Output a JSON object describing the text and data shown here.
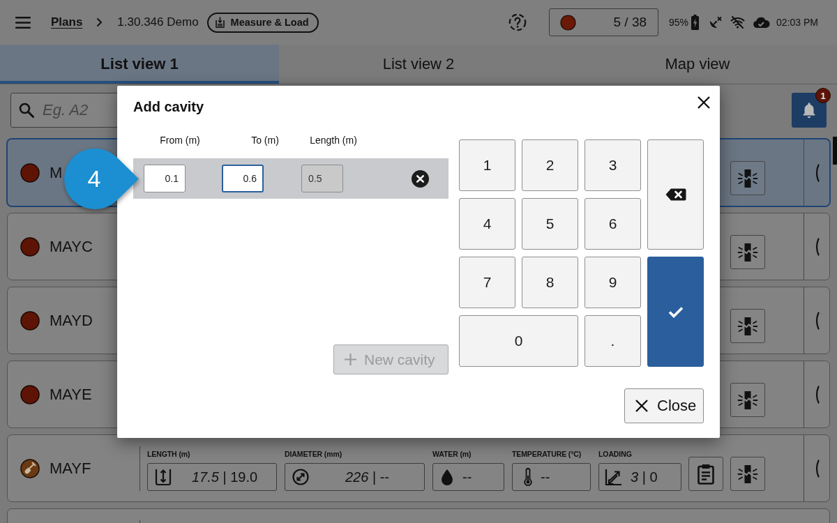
{
  "top_bar": {
    "breadcrumb_link": "Plans",
    "project": "1.30.346 Demo",
    "mode_chip": "Measure & Load",
    "counter": "5 / 38",
    "battery": "95%",
    "time": "02:03 PM"
  },
  "tabs": [
    {
      "label": "List view 1",
      "selected": true
    },
    {
      "label": "List view 2",
      "selected": false
    },
    {
      "label": "Map view",
      "selected": false
    }
  ],
  "search": {
    "placeholder": "Eg. A2"
  },
  "notifications": {
    "badge": "1"
  },
  "rows": [
    {
      "name": "M",
      "selected": true,
      "marker": {
        "kind": "dot",
        "color": "#5e1405"
      },
      "actions": [
        {
          "kind": "breakage"
        }
      ]
    },
    {
      "name": "MAYC",
      "selected": false,
      "marker": {
        "kind": "dot",
        "color": "#5e1405"
      },
      "actions": [
        {
          "kind": "breakage"
        }
      ]
    },
    {
      "name": "MAYD",
      "selected": false,
      "marker": {
        "kind": "dot",
        "color": "#5e1405"
      },
      "actions": [
        {
          "kind": "breakage"
        }
      ]
    },
    {
      "name": "MAYE",
      "selected": false,
      "marker": {
        "kind": "dot",
        "color": "#5e1405"
      },
      "actions": [
        {
          "kind": "breakage"
        }
      ]
    },
    {
      "name": "MAYF",
      "selected": false,
      "marker": {
        "kind": "shovel",
        "color": "#6b3a12"
      },
      "fields": [
        {
          "kind": "length",
          "label": "LENGTH (m)",
          "value": "*17.5* | 19.0"
        },
        {
          "kind": "diameter",
          "label": "DIAMETER (mm)",
          "value": "*226* | --"
        },
        {
          "kind": "water",
          "label": "WATER (m)",
          "value": "--"
        },
        {
          "kind": "temperature",
          "label": "TEMPERATURE (°C)",
          "value": "--"
        },
        {
          "kind": "loading",
          "label": "LOADING",
          "value": "*3* | 0"
        }
      ],
      "actions": [
        {
          "kind": "clipboard"
        },
        {
          "kind": "breakage"
        }
      ]
    }
  ],
  "dialog": {
    "title": "Add cavity",
    "columns": [
      "From (m)",
      "To (m)",
      "Length (m)"
    ],
    "cavities": [
      {
        "inputs": [
          {
            "value": "0.1",
            "focused": false,
            "disabled": false
          },
          {
            "value": "0.6",
            "focused": true,
            "disabled": false
          },
          {
            "value": "0.5",
            "focused": false,
            "disabled": true
          }
        ]
      }
    ],
    "new_cavity": {
      "label": "New cavity",
      "disabled": true
    },
    "keypad": [
      {
        "kind": "key",
        "label": "1"
      },
      {
        "kind": "key",
        "label": "2"
      },
      {
        "kind": "key",
        "label": "3"
      },
      {
        "kind": "backspace"
      },
      {
        "kind": "key",
        "label": "4"
      },
      {
        "kind": "key",
        "label": "5"
      },
      {
        "kind": "key",
        "label": "6"
      },
      {
        "kind": "key",
        "label": "7"
      },
      {
        "kind": "key",
        "label": "8"
      },
      {
        "kind": "key",
        "label": "9"
      },
      {
        "kind": "confirm"
      },
      {
        "kind": "wide_key",
        "label": "0"
      },
      {
        "kind": "key",
        "label": "."
      }
    ],
    "close_button": "Close"
  },
  "callout": {
    "label": "4"
  }
}
